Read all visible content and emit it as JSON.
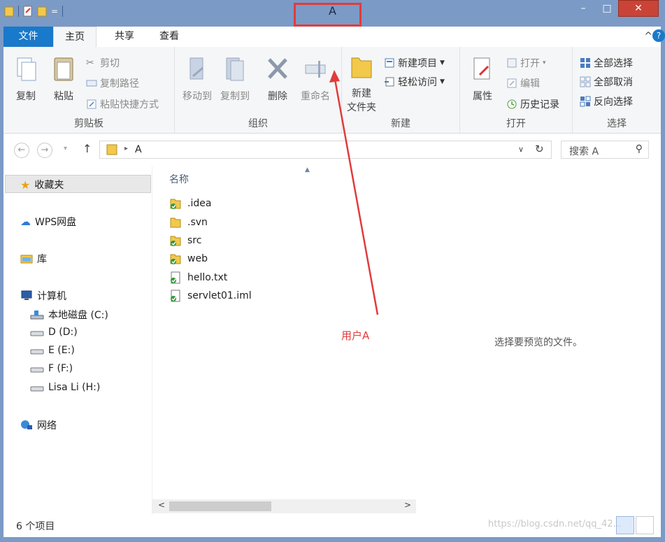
{
  "window": {
    "title": "A",
    "min_glyph": "–",
    "max_glyph": "□",
    "close_glyph": "✕",
    "qat_dropdown_glyph": "="
  },
  "ribbon_tabs": [
    {
      "label": "文件"
    },
    {
      "label": "主页"
    },
    {
      "label": "共享"
    },
    {
      "label": "查看"
    }
  ],
  "ribbon_controls": {
    "collapse_glyph": "^",
    "help_glyph": "?"
  },
  "ribbon": {
    "clipboard": {
      "copy": "复制",
      "paste": "粘贴",
      "cut": "剪切",
      "copy_path": "复制路径",
      "paste_shortcut": "粘贴快捷方式",
      "group_label": "剪贴板"
    },
    "organize": {
      "move_to": "移动到",
      "copy_to": "复制到",
      "delete": "删除",
      "rename": "重命名",
      "group_label": "组织"
    },
    "new": {
      "new_folder_line1": "新建",
      "new_folder_line2": "文件夹",
      "new_item": "新建项目",
      "easy_access": "轻松访问",
      "group_label": "新建"
    },
    "open": {
      "properties": "属性",
      "open": "打开",
      "edit": "编辑",
      "history": "历史记录",
      "group_label": "打开"
    },
    "select": {
      "select_all": "全部选择",
      "select_none": "全部取消",
      "invert": "反向选择",
      "group_label": "选择"
    }
  },
  "address": {
    "back_glyph": "←",
    "forward_glyph": "→",
    "recent_glyph": "▾",
    "up_glyph": "↑",
    "chevron_glyph": "▸",
    "dropdown_glyph": "∨",
    "refresh_glyph": "↻",
    "path": "A",
    "search_placeholder": "搜索 A",
    "search_glyph": "⚲"
  },
  "nav": {
    "favorites": "收藏夹",
    "wps": "WPS网盘",
    "library": "库",
    "computer": "计算机",
    "drives": [
      "本地磁盘 (C:)",
      "D (D:)",
      "E (E:)",
      "F (F:)",
      "Lisa Li (H:)"
    ],
    "network": "网络"
  },
  "files": {
    "column_name": "名称",
    "sort_glyph": "▲",
    "items": [
      {
        "name": ".idea",
        "type": "folder",
        "svn": "ok"
      },
      {
        "name": ".svn",
        "type": "folder",
        "svn": "none"
      },
      {
        "name": "src",
        "type": "folder",
        "svn": "ok"
      },
      {
        "name": "web",
        "type": "folder",
        "svn": "ok"
      },
      {
        "name": "hello.txt",
        "type": "file",
        "svn": "ok"
      },
      {
        "name": "servlet01.iml",
        "type": "file",
        "svn": "ok"
      }
    ],
    "scroll_left_glyph": "<",
    "scroll_right_glyph": ">"
  },
  "preview": {
    "message": "选择要预览的文件。"
  },
  "status": {
    "item_count": "6 个项目"
  },
  "annotation": {
    "label": "用户A",
    "color": "#e23b3b"
  },
  "watermark": "https://blog.csdn.net/qq_42..."
}
